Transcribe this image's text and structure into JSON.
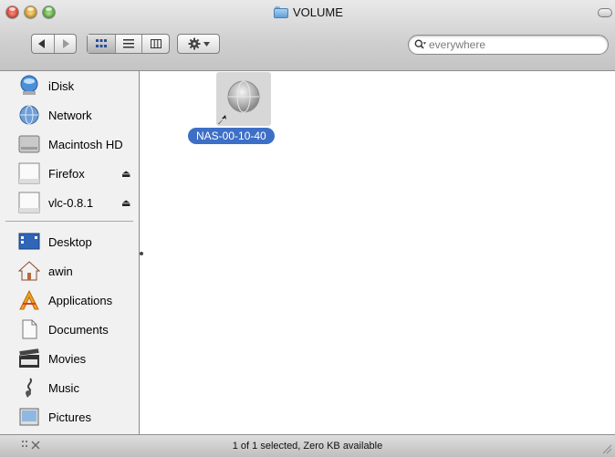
{
  "window": {
    "title": "VOLUME"
  },
  "toolbar": {
    "back_icon": "back-arrow-icon",
    "forward_icon": "forward-arrow-icon",
    "views": [
      "icon-view-icon",
      "list-view-icon",
      "column-view-icon"
    ],
    "action_icon": "gear-icon",
    "search": {
      "placeholder": "everywhere",
      "value": ""
    }
  },
  "sidebar": {
    "items": [
      {
        "label": "iDisk",
        "icon": "idisk-icon",
        "eject": false
      },
      {
        "label": "Network",
        "icon": "network-globe-icon",
        "eject": false
      },
      {
        "label": "Macintosh HD",
        "icon": "hard-drive-icon",
        "eject": false
      },
      {
        "label": "Firefox",
        "icon": "disk-image-icon",
        "eject": true
      },
      {
        "label": "vlc-0.8.1",
        "icon": "disk-image-icon",
        "eject": true
      },
      {
        "label": "Desktop",
        "icon": "desktop-icon",
        "eject": false
      },
      {
        "label": "awin",
        "icon": "home-icon",
        "eject": false
      },
      {
        "label": "Applications",
        "icon": "applications-icon",
        "eject": false
      },
      {
        "label": "Documents",
        "icon": "documents-icon",
        "eject": false
      },
      {
        "label": "Movies",
        "icon": "movies-clapper-icon",
        "eject": false
      },
      {
        "label": "Music",
        "icon": "music-note-icon",
        "eject": false
      },
      {
        "label": "Pictures",
        "icon": "pictures-icon",
        "eject": false
      }
    ],
    "eject_glyph": "⏏"
  },
  "content": {
    "files": [
      {
        "name": "NAS-00-10-40",
        "icon": "server-alias-icon",
        "selected": true
      }
    ]
  },
  "statusbar": {
    "text": "1 of 1 selected, Zero KB available"
  }
}
